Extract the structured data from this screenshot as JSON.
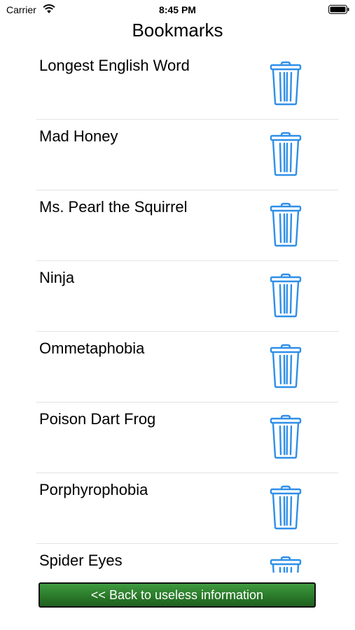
{
  "status_bar": {
    "carrier": "Carrier",
    "time": "8:45 PM"
  },
  "title": "Bookmarks",
  "bookmarks": [
    {
      "label": "Longest English Word",
      "icon": "trash-icon"
    },
    {
      "label": "Mad Honey",
      "icon": "trash-icon"
    },
    {
      "label": "Ms. Pearl the Squirrel",
      "icon": "trash-icon"
    },
    {
      "label": "Ninja",
      "icon": "trash-icon"
    },
    {
      "label": "Ommetaphobia",
      "icon": "trash-icon"
    },
    {
      "label": "Poison Dart Frog",
      "icon": "trash-icon"
    },
    {
      "label": "Porphyrophobia",
      "icon": "trash-icon"
    },
    {
      "label": "Spider Eyes",
      "icon": "trash-icon"
    }
  ],
  "back_button": {
    "label": "<< Back to useless information"
  },
  "colors": {
    "trash": "#2f8fe8",
    "button_green": "#2a7a2a",
    "separator": "#e3e3e3"
  }
}
